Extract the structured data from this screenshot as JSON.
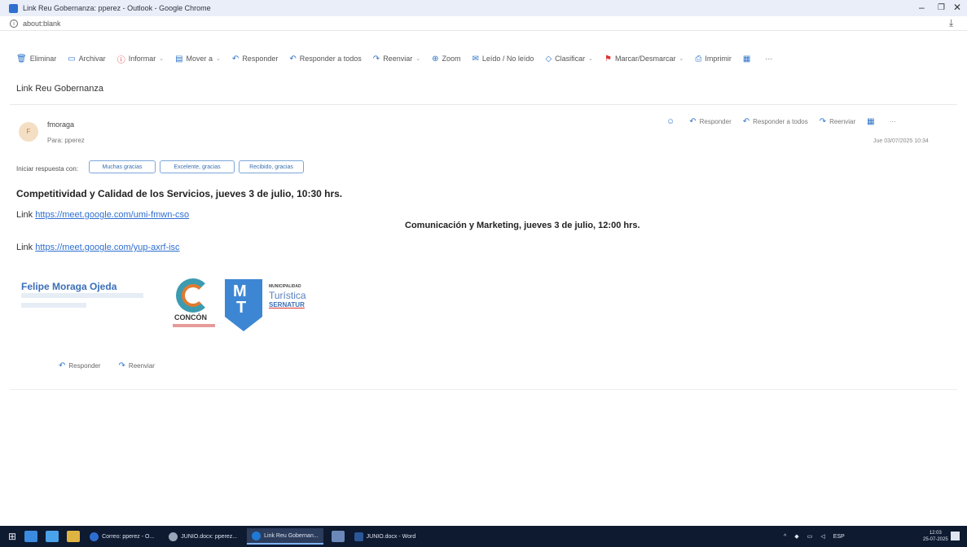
{
  "window": {
    "title": "Link Reu Gobernanza: pperez - Outlook - Google Chrome",
    "url": "about:blank"
  },
  "toolbar": {
    "items": [
      {
        "label": "Eliminar",
        "icon": "trash-icon"
      },
      {
        "label": "Archivar",
        "icon": "archive-icon"
      },
      {
        "label": "Informar",
        "icon": "report-icon",
        "dropdown": true
      },
      {
        "label": "Mover a",
        "icon": "move-icon",
        "dropdown": true
      },
      {
        "label": "Responder",
        "icon": "reply-icon"
      },
      {
        "label": "Responder a todos",
        "icon": "reply-all-icon"
      },
      {
        "label": "Reenviar",
        "icon": "forward-icon",
        "dropdown": true
      },
      {
        "label": "Zoom",
        "icon": "zoom-icon"
      },
      {
        "label": "Leído / No leído",
        "icon": "read-unread-icon"
      },
      {
        "label": "Clasificar",
        "icon": "categorize-icon",
        "dropdown": true
      },
      {
        "label": "Marcar/Desmarcar",
        "icon": "flag-icon",
        "dropdown": true
      },
      {
        "label": "Imprimir",
        "icon": "print-icon"
      }
    ]
  },
  "email": {
    "subject": "Link Reu Gobernanza",
    "sender": "fmoraga",
    "to": "Para: pperez",
    "date": "Jue 03/07/2025 10:34",
    "actions": {
      "reply": "Responder",
      "reply_all": "Responder a todos",
      "forward": "Reenviar"
    },
    "quick_reply_label": "Iniciar respuesta con:",
    "quick_replies": [
      "Muchas gracias",
      "Excelente, gracias",
      "Recibido, gracias"
    ],
    "body": {
      "line1": "Competitividad y Calidad de los Servicios, jueves 3 de julio, 10:30 hrs.",
      "link1_prefix": "Link",
      "link1": "https://meet.google.com/umi-fmwn-cso",
      "line2": "Comunicación y Marketing, jueves 3 de julio, 12:00 hrs.",
      "link2_prefix": "Link",
      "link2": "https://meet.google.com/yup-axrf-isc"
    },
    "signature": {
      "name": "Felipe Moraga Ojeda",
      "logo_concon": "CONCÓN",
      "logo_sernatur_l1": "MUNICIPALIDAD",
      "logo_sernatur_l2": "Turística",
      "logo_sernatur_l3": "SERNATUR"
    },
    "bottom_actions": {
      "reply": "Responder",
      "forward": "Reenviar"
    }
  },
  "taskbar": {
    "tasks": [
      {
        "label": "Correo: pperez - O...",
        "color": "#2d6fd1",
        "active": false
      },
      {
        "label": "JUNIO.docx: pperez...",
        "color": "#9aa6b8",
        "active": false
      },
      {
        "label": "Link Reu Gobernan...",
        "color": "#1f7ad6",
        "active": true
      },
      {
        "label": "JUNIO.docx - Word",
        "color": "#2b5797",
        "active": false
      }
    ],
    "tray_lang": "ESP",
    "time": "12:03",
    "date": "25-07-2025"
  }
}
